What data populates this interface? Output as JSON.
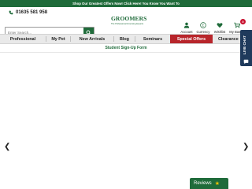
{
  "topbar": {
    "text": "Shop Our Greatest Offers Now! Click Here! You Know You Want To"
  },
  "header": {
    "phone": "01635 581 958",
    "logo": {
      "name": "GROOMERS",
      "tagline": "The Professional Grooming Experts"
    },
    "search_placeholder": "Enter Search...",
    "account_label": "Account",
    "currency_label": "Currency",
    "currency_symbol": "£",
    "wishlist_label": "Wishlist",
    "basket_label": "My Basket",
    "basket_count": "0"
  },
  "nav": {
    "items": [
      "Professional",
      "My Pet",
      "New Arrivals",
      "Blog",
      "Seminars",
      "Special Offers",
      "Clearance"
    ]
  },
  "subline": "Student Sign-Up Form",
  "livechat": {
    "label": "LIVE CHAT"
  },
  "reviews": {
    "label": "Reviews",
    "star": "★"
  },
  "carousel": {
    "prev": "❮",
    "next": "❯"
  },
  "colors": {
    "brand_green": "#1f6b3a",
    "special_red": "#b8252b",
    "chat_navy": "#1f3a5c",
    "badge_red": "#c8102e"
  }
}
